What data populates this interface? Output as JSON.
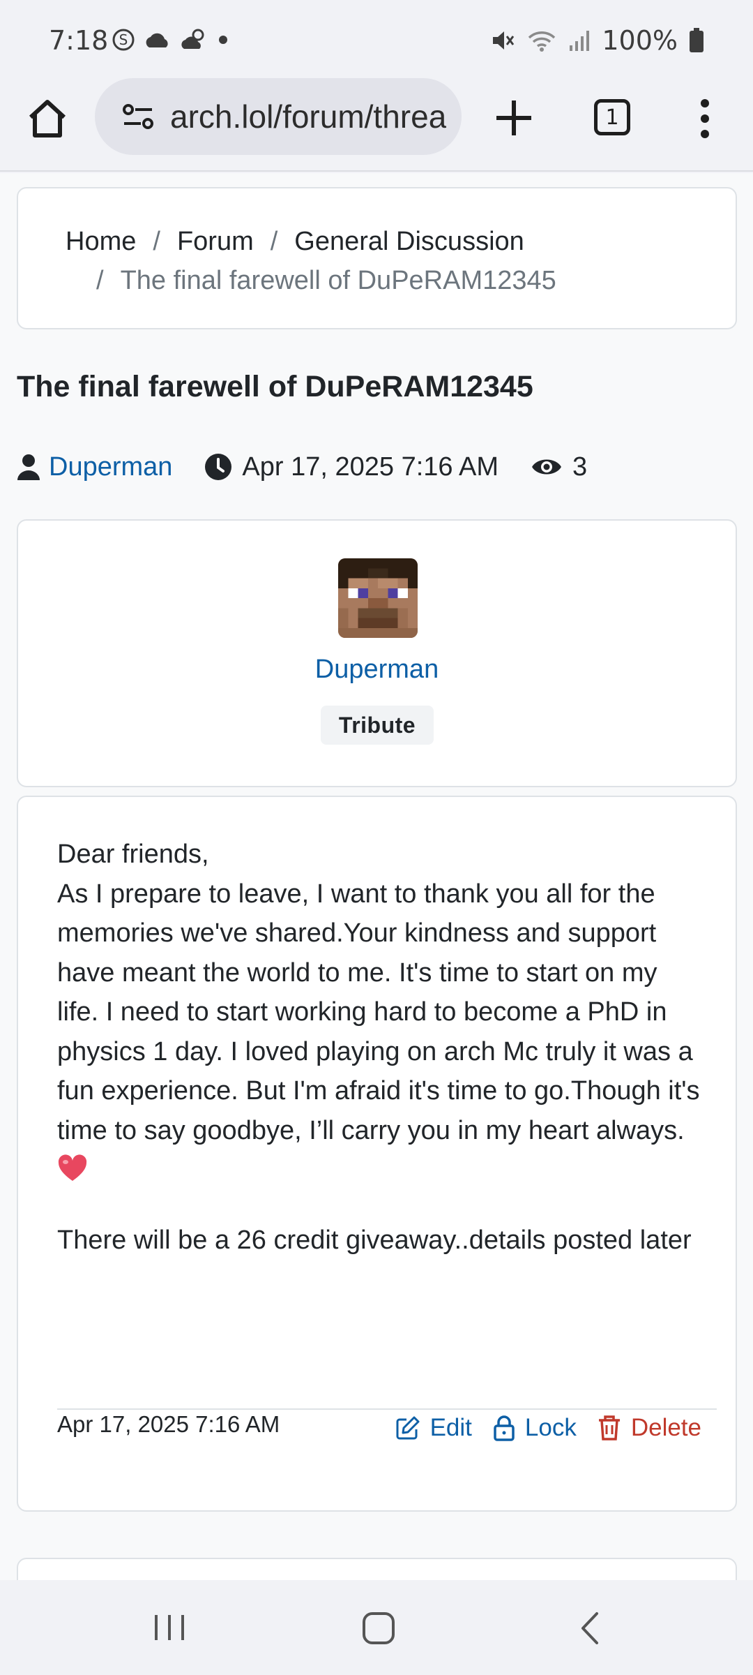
{
  "status_bar": {
    "time": "7:18",
    "battery": "100%",
    "icons": [
      "skype-icon",
      "cloud-icon",
      "weather-icon",
      "dot-icon",
      "mute-icon",
      "wifi-icon",
      "signal-icon",
      "battery-icon"
    ]
  },
  "browser": {
    "url": "arch.lol/forum/threa",
    "tab_count": "1"
  },
  "breadcrumb": {
    "items": [
      "Home",
      "Forum",
      "General Discussion"
    ],
    "current": "The final farewell of DuPeRAM12345",
    "separator": "/"
  },
  "thread": {
    "title": "The final farewell of DuPeRAM12345",
    "author": "Duperman",
    "date": "Apr 17, 2025 7:16 AM",
    "views": "3"
  },
  "author_card": {
    "name": "Duperman",
    "role": "Tribute"
  },
  "post": {
    "paragraph1": "Dear friends,\nAs I prepare to leave, I want to thank you all for the memories we've shared.Your kindness and support have meant the world to me. It's time to start on my life. I need to start working hard to become a PhD in physics 1 day. I loved playing on arch Mc truly it was a fun experience. But I'm afraid it's time to go.Though it's time to say goodbye, I’ll carry you in my heart always.",
    "paragraph2": "There will be a 26 credit giveaway..details posted later",
    "date": "Apr 17, 2025 7:16 AM",
    "actions": {
      "edit": "Edit",
      "lock": "Lock",
      "delete": "Delete"
    }
  },
  "colors": {
    "link": "#0d5fa6",
    "danger": "#c0392b",
    "text": "#212529",
    "muted": "#6c757d"
  }
}
